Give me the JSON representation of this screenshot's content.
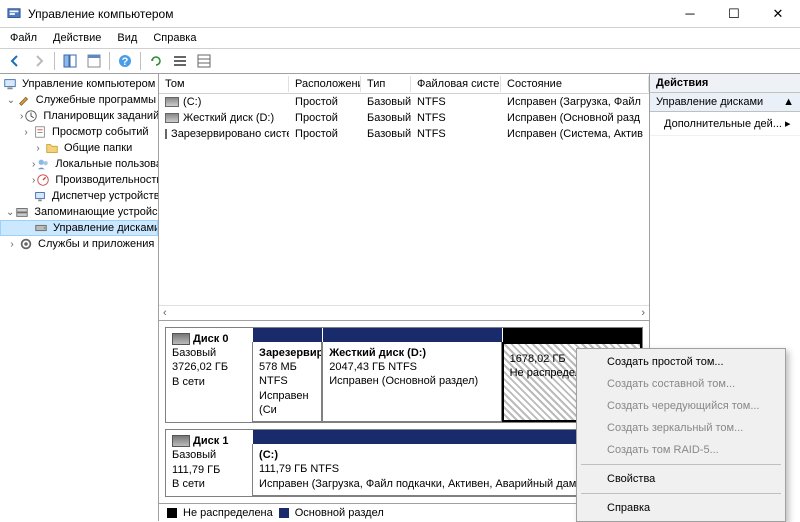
{
  "window": {
    "title": "Управление компьютером"
  },
  "menu": {
    "file": "Файл",
    "action": "Действие",
    "view": "Вид",
    "help": "Справка"
  },
  "tree": {
    "root": "Управление компьютером (л",
    "system_tools": "Служебные программы",
    "task_scheduler": "Планировщик заданий",
    "event_viewer": "Просмотр событий",
    "shared_folders": "Общие папки",
    "local_users": "Локальные пользоват",
    "performance": "Производительность",
    "device_manager": "Диспетчер устройств",
    "storage": "Запоминающие устройс",
    "disk_management": "Управление дисками",
    "services": "Службы и приложения"
  },
  "vol_headers": {
    "vol": "Том",
    "layout": "Расположение",
    "type": "Тип",
    "fs": "Файловая система",
    "status": "Состояние"
  },
  "volumes": [
    {
      "name": "(C:)",
      "layout": "Простой",
      "type": "Базовый",
      "fs": "NTFS",
      "status": "Исправен (Загрузка, Файл"
    },
    {
      "name": "Жесткий диск (D:)",
      "layout": "Простой",
      "type": "Базовый",
      "fs": "NTFS",
      "status": "Исправен (Основной разд"
    },
    {
      "name": "Зарезервировано системой",
      "layout": "Простой",
      "type": "Базовый",
      "fs": "NTFS",
      "status": "Исправен (Система, Актив"
    }
  ],
  "disks": {
    "d0": {
      "name": "Диск 0",
      "type": "Базовый",
      "size": "3726,02 ГБ",
      "state": "В сети",
      "p0": {
        "name": "Зарезервиро",
        "sz": "578 МБ NTFS",
        "st": "Исправен (Си"
      },
      "p1": {
        "name": "Жесткий диск  (D:)",
        "sz": "2047,43 ГБ NTFS",
        "st": "Исправен (Основной раздел)"
      },
      "p2": {
        "sz": "1678,02 ГБ",
        "st": "Не распределена"
      }
    },
    "d1": {
      "name": "Диск 1",
      "type": "Базовый",
      "size": "111,79 ГБ",
      "state": "В сети",
      "p0": {
        "name": "(C:)",
        "sz": "111,79 ГБ NTFS",
        "st": "Исправен (Загрузка, Файл подкачки, Активен, Аварийный дамп п"
      }
    }
  },
  "legend": {
    "unalloc": "Не распределена",
    "primary": "Основной раздел"
  },
  "actions": {
    "header": "Действия",
    "section": "Управление дисками",
    "more": "Дополнительные дей..."
  },
  "context": {
    "simple": "Создать простой том...",
    "spanned": "Создать составной том...",
    "striped": "Создать чередующийся том...",
    "mirror": "Создать зеркальный том...",
    "raid5": "Создать том RAID-5...",
    "props": "Свойства",
    "help": "Справка"
  }
}
